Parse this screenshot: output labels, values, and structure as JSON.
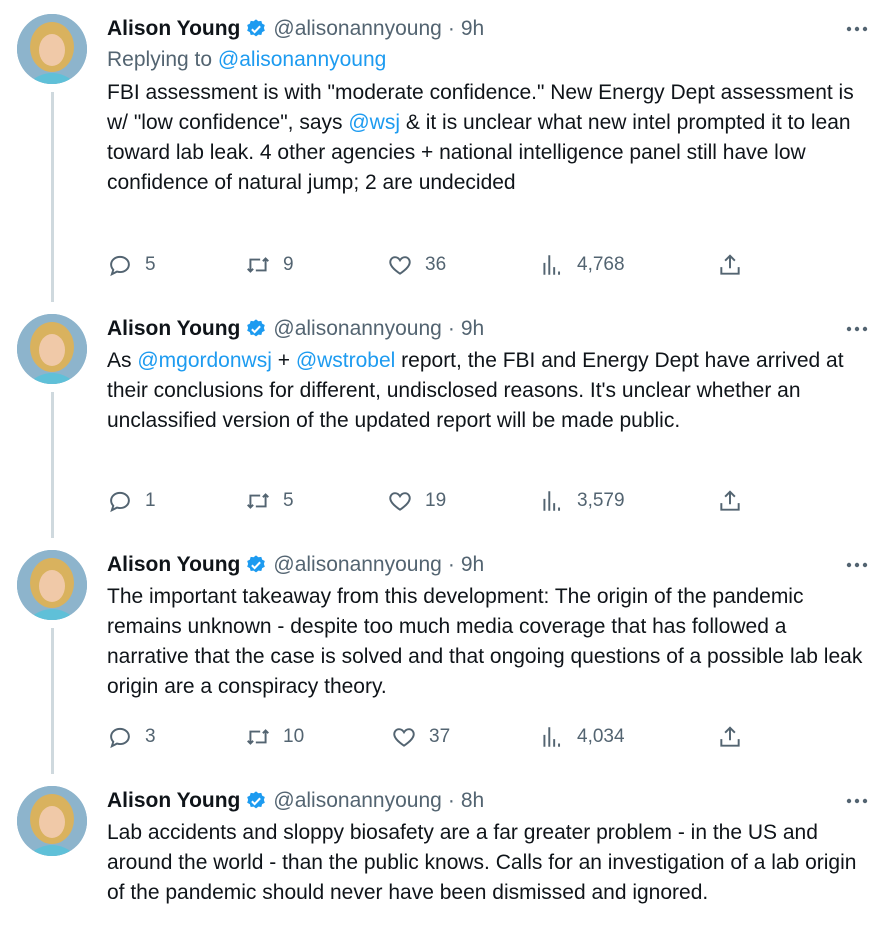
{
  "tweets": [
    {
      "name": "Alison Young",
      "handle": "@alisonannyoung",
      "dot": "·",
      "time": "9h",
      "reply_prefix": "Replying to ",
      "reply_handle": "@alisonannyoung",
      "text_1": "FBI assessment is with \"moderate confidence.\" New Energy Dept assessment is w/ \"low confidence\", says ",
      "mention_1": "@wsj",
      "text_2": " & it is unclear what new intel prompted it to lean toward lab leak. 4 other agencies + national intelligence panel still have low confidence of natural jump; 2 are undecided",
      "replies": "5",
      "retweets": "9",
      "likes": "36",
      "views": "4,768"
    },
    {
      "name": "Alison Young",
      "handle": "@alisonannyoung",
      "dot": "·",
      "time": "9h",
      "text_1": "As ",
      "mention_1": "@mgordonwsj",
      "text_2": " + ",
      "mention_2": "@wstrobel",
      "text_3": " report, the FBI and Energy Dept have arrived at their conclusions for different, undisclosed reasons. It's unclear whether an unclassified version of the updated report will be made public.",
      "replies": "1",
      "retweets": "5",
      "likes": "19",
      "views": "3,579"
    },
    {
      "name": "Alison Young",
      "handle": "@alisonannyoung",
      "dot": "·",
      "time": "9h",
      "text_1": "The important takeaway from this development: The origin of the pandemic remains unknown - despite too much media coverage that has followed a narrative that the case is solved and that ongoing questions of a possible lab leak origin are a conspiracy theory.",
      "replies": "3",
      "retweets": "10",
      "likes": "37",
      "views": "4,034"
    },
    {
      "name": "Alison Young",
      "handle": "@alisonannyoung",
      "dot": "·",
      "time": "8h",
      "text_1": "Lab accidents and sloppy biosafety are a far greater problem - in the US and around the world - than the public knows. Calls for an investigation of a lab origin of the pandemic should never have been dismissed and ignored."
    }
  ],
  "icons": {
    "verified": "verified-badge-icon",
    "more": "more-options-icon",
    "reply": "reply-icon",
    "retweet": "retweet-icon",
    "like": "like-icon",
    "views": "views-icon",
    "share": "share-icon"
  },
  "colors": {
    "link": "#1d9bf0",
    "muted": "#536471",
    "text": "#0f1419",
    "thread": "#cfd9de"
  }
}
